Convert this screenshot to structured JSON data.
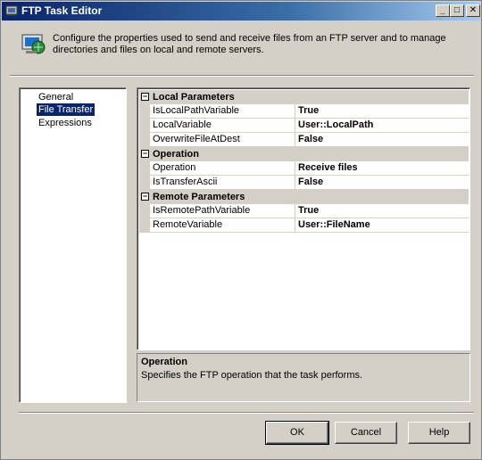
{
  "window": {
    "title": "FTP Task Editor",
    "controls": {
      "minimize": "_",
      "maximize": "□",
      "close": "✕"
    }
  },
  "header": {
    "icon": "ftp-task-icon",
    "text": "Configure the properties used to send and receive files from an FTP server and to manage directories and files on local and remote servers."
  },
  "nav": {
    "items": [
      {
        "label": "General",
        "selected": false
      },
      {
        "label": "File Transfer",
        "selected": true
      },
      {
        "label": "Expressions",
        "selected": false
      }
    ]
  },
  "properties": {
    "categories": [
      {
        "label": "Local Parameters",
        "toggle": "⊟",
        "rows": [
          {
            "name": "IsLocalPathVariable",
            "value": "True"
          },
          {
            "name": "LocalVariable",
            "value": "User::LocalPath"
          },
          {
            "name": "OverwriteFileAtDest",
            "value": "False"
          }
        ]
      },
      {
        "label": "Operation",
        "toggle": "⊟",
        "rows": [
          {
            "name": "Operation",
            "value": "Receive files"
          },
          {
            "name": "IsTransferAscii",
            "value": "False"
          }
        ]
      },
      {
        "label": "Remote Parameters",
        "toggle": "⊟",
        "rows": [
          {
            "name": "IsRemotePathVariable",
            "value": "True"
          },
          {
            "name": "RemoteVariable",
            "value": "User::FileName"
          }
        ]
      }
    ]
  },
  "description": {
    "title": "Operation",
    "text": "Specifies the FTP operation that the task performs."
  },
  "buttons": {
    "ok": "OK",
    "cancel": "Cancel",
    "help": "Help"
  },
  "colors": {
    "titlebar_start": "#0a246a",
    "titlebar_end": "#a6caf0",
    "face": "#d4d0c8",
    "selection": "#0a246a"
  }
}
